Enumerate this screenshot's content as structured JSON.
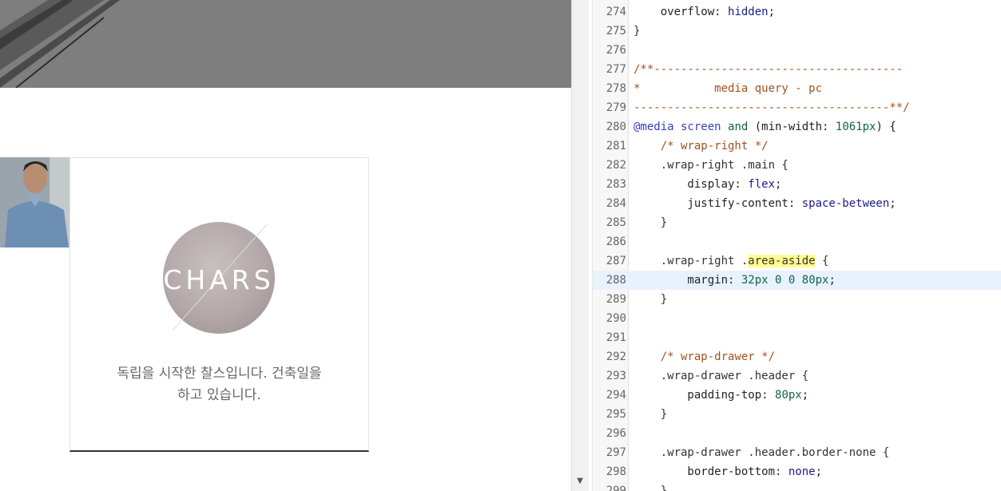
{
  "preview": {
    "logo_text": "CHARS",
    "card_text_line1": "독립을 시작한 찰스입니다. 건축일을",
    "card_text_line2": "하고 있습니다."
  },
  "scrollbar": {
    "down_arrow_glyph": "▼"
  },
  "editor": {
    "lines": [
      {
        "n": "274",
        "t": "    overflow: hidden;"
      },
      {
        "n": "275",
        "t": "}"
      },
      {
        "n": "276",
        "t": ""
      },
      {
        "n": "277",
        "t": "/**-------------------------------------"
      },
      {
        "n": "278",
        "t": "*           media query - pc"
      },
      {
        "n": "279",
        "t": "--------------------------------------**/"
      },
      {
        "n": "280",
        "t": "@media screen and (min-width: 1061px) {"
      },
      {
        "n": "281",
        "t": "    /* wrap-right */"
      },
      {
        "n": "282",
        "t": "    .wrap-right .main {"
      },
      {
        "n": "283",
        "t": "        display: flex;"
      },
      {
        "n": "284",
        "t": "        justify-content: space-between;"
      },
      {
        "n": "285",
        "t": "    }"
      },
      {
        "n": "286",
        "t": ""
      },
      {
        "n": "287",
        "t": "    .wrap-right .area-aside {"
      },
      {
        "n": "288",
        "t": "        margin: 32px 0 0 80px;"
      },
      {
        "n": "289",
        "t": "    }"
      },
      {
        "n": "290",
        "t": ""
      },
      {
        "n": "291",
        "t": ""
      },
      {
        "n": "292",
        "t": "    /* wrap-drawer */"
      },
      {
        "n": "293",
        "t": "    .wrap-drawer .header {"
      },
      {
        "n": "294",
        "t": "        padding-top: 80px;"
      },
      {
        "n": "295",
        "t": "    }"
      },
      {
        "n": "296",
        "t": ""
      },
      {
        "n": "297",
        "t": "    .wrap-drawer .header.border-none {"
      },
      {
        "n": "298",
        "t": "        border-bottom: none;"
      },
      {
        "n": "299",
        "t": "    }"
      }
    ],
    "active_line": "288",
    "highlighted_token": "area-aside"
  },
  "colors": {
    "comment": "#a0521e",
    "at_rule": "#3a3ac4",
    "number": "#116644",
    "value": "#1a1a8a",
    "active_line_bg": "#e8f2ff",
    "search_highlight": "#fffd91"
  }
}
